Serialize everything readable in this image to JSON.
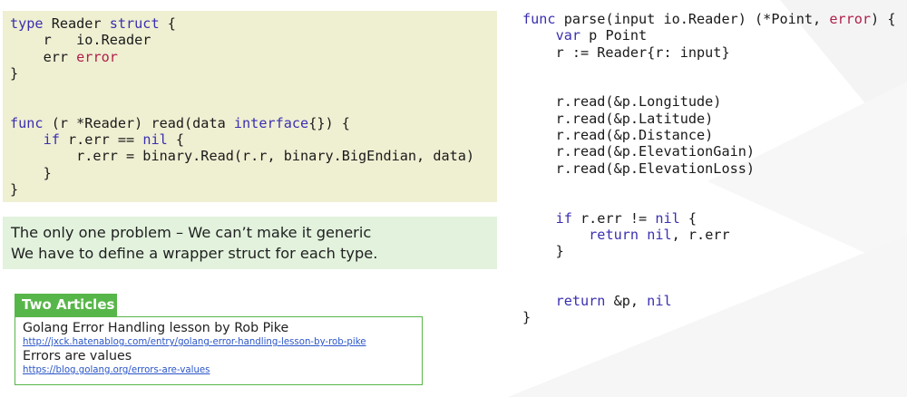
{
  "left_code": {
    "lines": [
      [
        {
          "t": "type",
          "k": "kw"
        },
        {
          "t": " Reader ",
          "k": "plain"
        },
        {
          "t": "struct",
          "k": "kw"
        },
        {
          "t": " {",
          "k": "plain"
        }
      ],
      [
        {
          "t": "    r   io.Reader",
          "k": "plain"
        }
      ],
      [
        {
          "t": "    err ",
          "k": "plain"
        },
        {
          "t": "error",
          "k": "kw2"
        }
      ],
      [
        {
          "t": "}",
          "k": "plain"
        }
      ],
      [
        {
          "t": "",
          "k": "plain"
        }
      ],
      [
        {
          "t": "",
          "k": "plain"
        }
      ],
      [
        {
          "t": "func",
          "k": "kw"
        },
        {
          "t": " (r *Reader) read(data ",
          "k": "plain"
        },
        {
          "t": "interface",
          "k": "kw"
        },
        {
          "t": "{}) {",
          "k": "plain"
        }
      ],
      [
        {
          "t": "    ",
          "k": "plain"
        },
        {
          "t": "if",
          "k": "kw"
        },
        {
          "t": " r.err == ",
          "k": "plain"
        },
        {
          "t": "nil",
          "k": "kw"
        },
        {
          "t": " {",
          "k": "plain"
        }
      ],
      [
        {
          "t": "        r.err = binary.Read(r.r, binary.BigEndian, data)",
          "k": "plain"
        }
      ],
      [
        {
          "t": "    }",
          "k": "plain"
        }
      ],
      [
        {
          "t": "}",
          "k": "plain"
        }
      ]
    ]
  },
  "note": {
    "line1": "The only one problem – We can’t make it generic",
    "line2": "We have to define a wrapper struct for each type."
  },
  "articles": {
    "header": "Two Articles",
    "items": [
      {
        "title": "Golang Error Handling lesson by Rob Pike",
        "url": "http://jxck.hatenablog.com/entry/golang-error-handling-lesson-by-rob-pike"
      },
      {
        "title": "Errors are values",
        "url": "https://blog.golang.org/errors-are-values"
      }
    ]
  },
  "right_code": {
    "lines": [
      [
        {
          "t": "func",
          "k": "kw"
        },
        {
          "t": " parse(input io.Reader) (*Point, ",
          "k": "plain"
        },
        {
          "t": "error",
          "k": "kw2"
        },
        {
          "t": ") {",
          "k": "plain"
        }
      ],
      [
        {
          "t": "    ",
          "k": "plain"
        },
        {
          "t": "var",
          "k": "kw"
        },
        {
          "t": " p Point",
          "k": "plain"
        }
      ],
      [
        {
          "t": "    r := Reader{r: input}",
          "k": "plain"
        }
      ],
      [
        {
          "t": "",
          "k": "plain"
        }
      ],
      [
        {
          "t": "",
          "k": "plain"
        }
      ],
      [
        {
          "t": "    r.read(&p.Longitude)",
          "k": "plain"
        }
      ],
      [
        {
          "t": "    r.read(&p.Latitude)",
          "k": "plain"
        }
      ],
      [
        {
          "t": "    r.read(&p.Distance)",
          "k": "plain"
        }
      ],
      [
        {
          "t": "    r.read(&p.ElevationGain)",
          "k": "plain"
        }
      ],
      [
        {
          "t": "    r.read(&p.ElevationLoss)",
          "k": "plain"
        }
      ],
      [
        {
          "t": "",
          "k": "plain"
        }
      ],
      [
        {
          "t": "",
          "k": "plain"
        }
      ],
      [
        {
          "t": "    ",
          "k": "plain"
        },
        {
          "t": "if",
          "k": "kw"
        },
        {
          "t": " r.err != ",
          "k": "plain"
        },
        {
          "t": "nil",
          "k": "kw"
        },
        {
          "t": " {",
          "k": "plain"
        }
      ],
      [
        {
          "t": "        ",
          "k": "plain"
        },
        {
          "t": "return",
          "k": "kw"
        },
        {
          "t": " ",
          "k": "plain"
        },
        {
          "t": "nil",
          "k": "kw"
        },
        {
          "t": ", r.err",
          "k": "plain"
        }
      ],
      [
        {
          "t": "    }",
          "k": "plain"
        }
      ],
      [
        {
          "t": "",
          "k": "plain"
        }
      ],
      [
        {
          "t": "",
          "k": "plain"
        }
      ],
      [
        {
          "t": "    ",
          "k": "plain"
        },
        {
          "t": "return",
          "k": "kw"
        },
        {
          "t": " &p, ",
          "k": "plain"
        },
        {
          "t": "nil",
          "k": "kw"
        }
      ],
      [
        {
          "t": "}",
          "k": "plain"
        }
      ]
    ]
  }
}
